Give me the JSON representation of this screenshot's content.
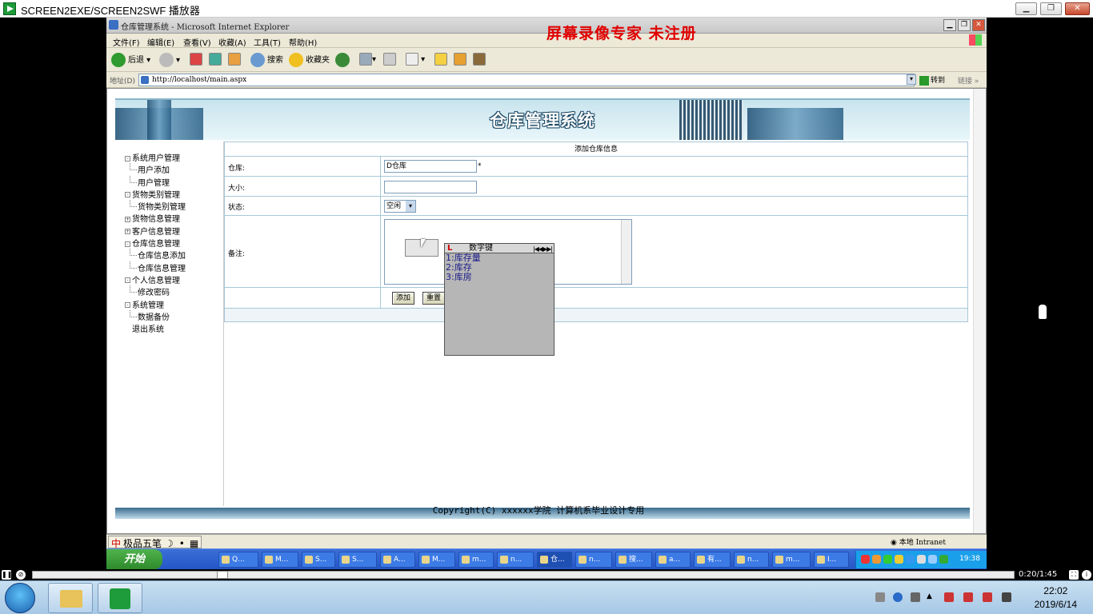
{
  "player": {
    "title": "SCREEN2EXE/SCREEN2SWF 播放器",
    "elapsed": "0:20/1:45",
    "progress_fraction": 0.19
  },
  "browser": {
    "title": "仓库管理系统 - Microsoft Internet Explorer",
    "watermark": "屏幕录像专家  未注册",
    "menu": [
      "文件(F)",
      "编辑(E)",
      "查看(V)",
      "收藏(A)",
      "工具(T)",
      "帮助(H)"
    ],
    "toolbar": {
      "back": "后退",
      "search": "搜索",
      "favorites": "收藏夹"
    },
    "address_label": "地址(D)",
    "address": "http://localhost/main.aspx",
    "go": "转到",
    "links": "链接",
    "zone": "本地 Intranet",
    "ime": "极品五笔"
  },
  "page": {
    "banner_title": "仓库管理系统",
    "tree": [
      {
        "label": "系统用户管理",
        "level": 0,
        "sign": "-"
      },
      {
        "label": "用户添加",
        "level": 1
      },
      {
        "label": "用户管理",
        "level": 1
      },
      {
        "label": "货物类别管理",
        "level": 0,
        "sign": "-"
      },
      {
        "label": "货物类别管理",
        "level": 1
      },
      {
        "label": "货物信息管理",
        "level": 0,
        "sign": "+"
      },
      {
        "label": "客户信息管理",
        "level": 0,
        "sign": "+"
      },
      {
        "label": "仓库信息管理",
        "level": 0,
        "sign": "-"
      },
      {
        "label": "仓库信息添加",
        "level": 1
      },
      {
        "label": "仓库信息管理",
        "level": 1
      },
      {
        "label": "个人信息管理",
        "level": 0,
        "sign": "-"
      },
      {
        "label": "修改密码",
        "level": 1
      },
      {
        "label": "系统管理",
        "level": 0,
        "sign": "-"
      },
      {
        "label": "数据备份",
        "level": 1
      },
      {
        "label": "退出系统",
        "level": 0,
        "sign": ""
      }
    ],
    "form": {
      "heading": "添加仓库信息",
      "warehouse_label": "仓库:",
      "warehouse_value": "D仓库",
      "required_mark": "*",
      "size_label": "大小:",
      "size_value": "",
      "status_label": "状态:",
      "status_value": "空闲",
      "note_label": "备注:",
      "note_value": "",
      "add_button": "添加",
      "reset_button": "重置"
    },
    "copyright": "Copyright(C) xxxxxx学院 计算机系毕业设计专用"
  },
  "ime_popup": {
    "title": "数字键",
    "candidates": [
      "1:库存量",
      "2:库存",
      "3:库房"
    ],
    "nav": "|◀◀▶▶|"
  },
  "xp_taskbar": {
    "start": "开始",
    "buttons": [
      "Q...",
      "M...",
      "S...",
      "S...",
      "A...",
      "M...",
      "m...",
      "n...",
      "仓...",
      "n...",
      "搜...",
      "a...",
      "有...",
      "n...",
      "m...",
      "I..."
    ],
    "active_index": 8,
    "time": "19:38"
  },
  "win7_taskbar": {
    "time": "22:02",
    "date": "2019/6/14"
  },
  "colors": {
    "watermark": "#e00000",
    "banner_title_stroke": "#1b4763",
    "xp_task": "#2456c7"
  }
}
